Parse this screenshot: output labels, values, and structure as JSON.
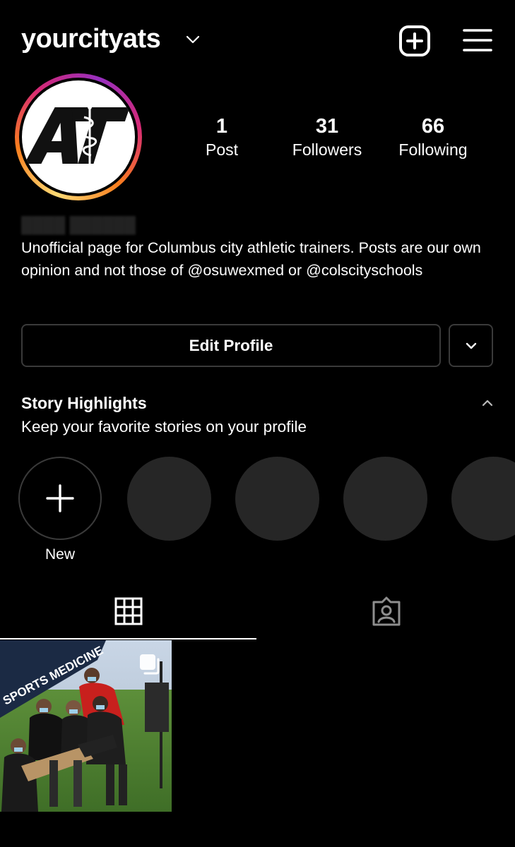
{
  "header": {
    "username": "yourcityats"
  },
  "profile": {
    "avatar_logo_text": "AT",
    "stats": [
      {
        "value": "1",
        "label": "Post"
      },
      {
        "value": "31",
        "label": "Followers"
      },
      {
        "value": "66",
        "label": "Following"
      }
    ],
    "bio": "Unofficial page for Columbus city athletic trainers. Posts are our own opinion and not those of @osuwexmed or @colscityschools"
  },
  "actions": {
    "edit_profile_label": "Edit Profile"
  },
  "highlights": {
    "title": "Story Highlights",
    "subtitle": "Keep your favorite stories on your profile",
    "new_label": "New"
  },
  "tabs": [
    "grid-icon",
    "tagged-icon"
  ],
  "posts": [
    {
      "banner_text": "SPORTS MEDICINE"
    }
  ],
  "colors": {
    "background": "#000000",
    "text": "#ffffff",
    "border": "#3a3a3a",
    "placeholder_circle": "#262626"
  }
}
